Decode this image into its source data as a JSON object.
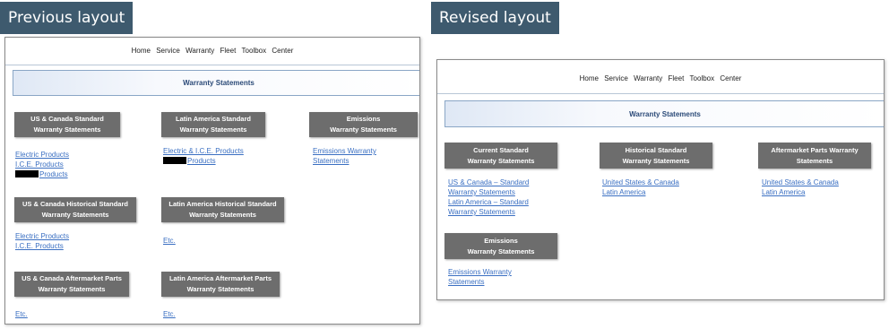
{
  "previous": {
    "tag": "Previous layout",
    "nav": [
      "Home",
      "Service",
      "Warranty",
      "Fleet",
      "Toolbox",
      "Center"
    ],
    "banner": "Warranty Statements",
    "categories": [
      {
        "line1": "US & Canada Standard",
        "line2": "Warranty Statements",
        "links": [
          "Electric Products",
          "I.C.E. Products",
          "Products"
        ]
      },
      {
        "line1": "Latin America Standard",
        "line2": "Warranty Statements",
        "links": [
          "Electric & I.C.E. Products",
          "Products"
        ]
      },
      {
        "line1": "Emissions",
        "line2": "Warranty Statements",
        "links": [
          "Emissions Warranty",
          "Statements"
        ]
      },
      {
        "line1": "US & Canada Historical Standard",
        "line2": "Warranty Statements",
        "links": [
          "Electric Products",
          "I.C.E. Products"
        ]
      },
      {
        "line1": "Latin America Historical Standard",
        "line2": "Warranty Statements",
        "links": [
          "Etc."
        ]
      },
      {
        "line1": "US & Canada Aftermarket Parts",
        "line2": "Warranty Statements",
        "links": [
          "Etc."
        ]
      },
      {
        "line1": "Latin America Aftermarket Parts",
        "line2": "Warranty Statements",
        "links": [
          "Etc."
        ]
      }
    ]
  },
  "revised": {
    "tag": "Revised layout",
    "nav": [
      "Home",
      "Service",
      "Warranty",
      "Fleet",
      "Toolbox",
      "Center"
    ],
    "banner": "Warranty Statements",
    "categories": [
      {
        "line1": "Current Standard",
        "line2": "Warranty Statements",
        "links": [
          "US & Canada – Standard",
          "Warranty Statements",
          "Latin America – Standard",
          "Warranty Statements"
        ]
      },
      {
        "line1": "Historical Standard",
        "line2": "Warranty Statements",
        "links": [
          "United States & Canada",
          "Latin America"
        ]
      },
      {
        "line1": "Aftermarket Parts Warranty",
        "line2": "Statements",
        "links": [
          "United States & Canada",
          "Latin America"
        ]
      },
      {
        "line1": "Emissions",
        "line2": "Warranty Statements",
        "links": [
          "Emissions Warranty",
          "Statements"
        ]
      }
    ]
  },
  "colors": {
    "tag": "#3e5a6e",
    "category_box": "#6d6d6d",
    "link": "#3a6fc2",
    "banner_text": "#2b4a78"
  }
}
